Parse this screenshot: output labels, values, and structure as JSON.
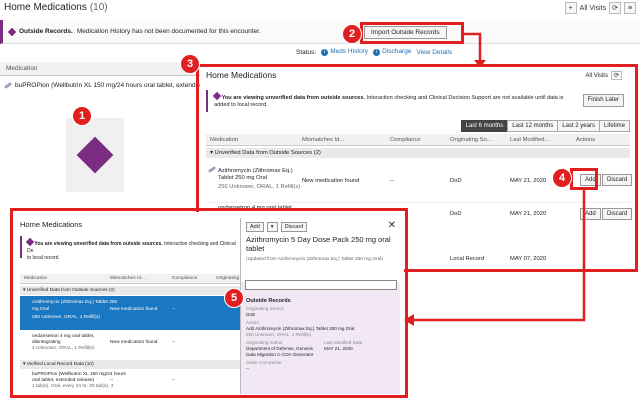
{
  "background": {
    "title": "Home Medications",
    "count": "(10)",
    "toolbar": {
      "add": "+",
      "all_visits": "All Visits",
      "refresh": "⟳",
      "menu": "≡"
    },
    "banner_bold": "Outside Records.",
    "banner_text": "Medication History has not been documented for this encounter.",
    "import_button": "Import Outside Records",
    "status_label": "Status:",
    "meds_history": "Meds History",
    "discharge": "Discharge",
    "view_details": "View Details",
    "column_medication": "Medication",
    "row_med": "buPROPion (Wellbutrin XL 150 mg/24 hours oral tablet, extended rele"
  },
  "callouts": {
    "c1": "1",
    "c2": "2",
    "c3": "3",
    "c4": "4",
    "c5": "5"
  },
  "panel3": {
    "title": "Home Medications",
    "all_visits": "All Visits",
    "banner_bold": "You are viewing unverified data from outside sources.",
    "banner_text": "Interaction checking and Clinical Decision Support are not available until data is added to local record.",
    "finish_later": "Finish Later",
    "tabs": [
      "Last 6 months",
      "Last 12 months",
      "Last 2 years",
      "Lifetime"
    ],
    "columns": [
      "Medication",
      "Mismatches Id...",
      "Compliance",
      "Originating So...",
      "Last Modified...",
      "Actions"
    ],
    "group_label": "Unverified Data from Outside Sources (2)",
    "row1": {
      "name": "Azithromycin (Zithromax Eq.) Tablet 250 mg Oral",
      "sub": "250 Unknown, ORAL, 1 Refill(s)",
      "mismatch": "New medication found",
      "compliance": "--",
      "source": "DoD",
      "modified": "MAY 21, 2020",
      "add": "Add",
      "discard": "Discard"
    },
    "row2": {
      "name": "ondansetron 4 mg oral tablet,",
      "source": "DoD",
      "modified": "MAY 21, 2020",
      "add": "Add",
      "discard": "Discard"
    },
    "row3": {
      "source": "Local Record",
      "modified": "MAY 07, 2020"
    }
  },
  "panel5": {
    "title": "Home Medications",
    "banner_bold": "You are viewing unverified data from outside sources.",
    "banner_text": "Interaction checking and Clinical De",
    "banner_text2": "to local record.",
    "columns": [
      "Medication",
      "Mismatches Id...",
      "Compliance",
      "Originating"
    ],
    "group1": "Unverified Data from Outside Sources (2)",
    "sel_name": "Azithromycin (Zithromax Eq.) Tablet 250",
    "sel_name2": "mg Oral",
    "sel_sub": "250 Unknown, ORAL, 1 Refill(s)",
    "sel_mismatch": "New medication found",
    "sel_compliance": "--",
    "row2_name": "ondansetron 4 mg oral tablet,",
    "row2_name2": "disintegrating",
    "row2_sub": "4 Unknown, ORAL, 1 Refill(s)",
    "row2_mismatch": "New medication found",
    "row2_compliance": "--",
    "group2": "Verified Local Record Data (10)",
    "row3_name": "buPROPion (Wellbutrin XL 150 mg/24 hours",
    "row3_name2": "oral tablet, extended release)",
    "row3_sub": "1 tab(s), Oral, every 24 hr, 30 tab(s), 3",
    "row3_mismatch": "--",
    "row3_compliance": "--"
  },
  "side": {
    "add": "Add",
    "dropdown": "▾",
    "discard": "Discard",
    "close": "✕",
    "name": "Azithromycin 5 Day Dose Pack 250 mg oral tablet",
    "sub": "(Updated from Azithromycin (Zithromax Eq.) Tablet 250 mg Oral)",
    "section": "Outside Records",
    "origin_label": "Originating Source",
    "origin": "DoD",
    "action_label": "Action",
    "action": "Add Azithromycin (Zithromax Eq.) Tablet 250 mg Oral",
    "action_sub": "250 Unknown, ORAL, 1 Refill(s)",
    "author_label": "Originating Author",
    "author": "Department of Defense, Genesis Data Migration C-CDA Generator",
    "modified_label": "Last Modified Data",
    "modified": "MAY 21, 2020",
    "comments_label": "Order Comments",
    "comments": "--"
  },
  "colors": {
    "callout": "#e02020",
    "accent": "#7b2d83",
    "selected": "#1a78c2"
  }
}
